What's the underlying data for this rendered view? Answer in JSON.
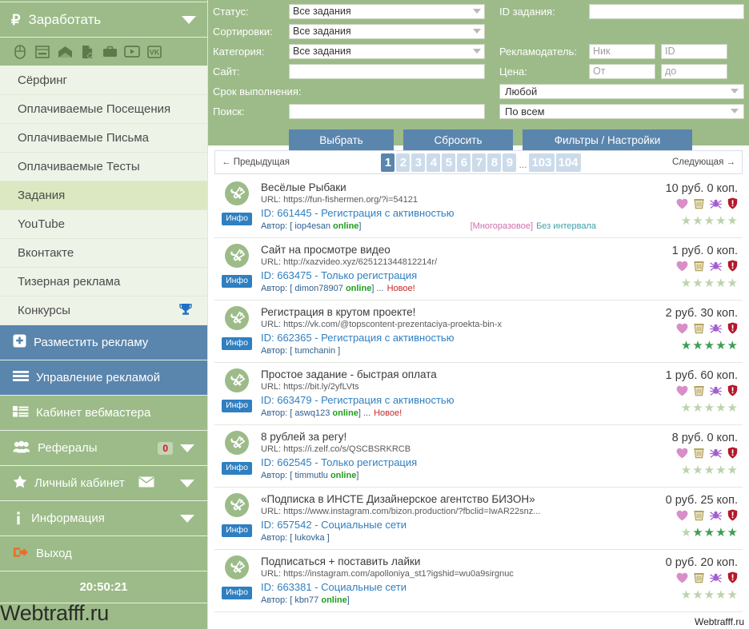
{
  "sidebar": {
    "header": {
      "label": "Заработать",
      "icon": "ruble-icon",
      "caret": "chevron-down-icon"
    },
    "quick_icons": [
      {
        "name": "mouse-icon"
      },
      {
        "name": "banner-icon"
      },
      {
        "name": "mail-open-icon"
      },
      {
        "name": "test-paper-icon"
      },
      {
        "name": "briefcase-icon"
      },
      {
        "name": "video-play-icon"
      },
      {
        "name": "vk-icon"
      }
    ],
    "items": [
      {
        "label": "Сёрфинг",
        "active": false
      },
      {
        "label": "Оплачиваемые Посещения",
        "active": false
      },
      {
        "label": "Оплачиваемые Письма",
        "active": false
      },
      {
        "label": "Оплачиваемые Тесты",
        "active": false
      },
      {
        "label": "Задания",
        "active": true
      },
      {
        "label": "YouTube",
        "active": false
      },
      {
        "label": "Вконтакте",
        "active": false
      },
      {
        "label": "Тизерная реклама",
        "active": false
      },
      {
        "label": "Конкурсы",
        "active": false,
        "trophy": true
      }
    ],
    "actions": [
      {
        "label": "Разместить рекламу",
        "style": "blue",
        "icon": "plus-square-icon"
      },
      {
        "label": "Управление рекламой",
        "style": "blue",
        "icon": "menu-bars-icon"
      },
      {
        "label": "Кабинет вебмастера",
        "style": "green",
        "icon": "list-blocks-icon"
      },
      {
        "label": "Рефералы",
        "style": "green",
        "icon": "users-icon",
        "badge": "0",
        "caret": true
      },
      {
        "label": "Личный кабинет",
        "style": "green",
        "icon": "star-icon",
        "mail": true,
        "caret": true
      },
      {
        "label": "Информация",
        "style": "green",
        "icon": "info-icon",
        "caret": true
      },
      {
        "label": "Выход",
        "style": "green",
        "icon": "logout-icon"
      }
    ],
    "clock": "20:50:21",
    "watermark": "Webtrafff.ru"
  },
  "filters": {
    "status": {
      "label": "Статус:",
      "value": "Все задания"
    },
    "sorting": {
      "label": "Сортировки:",
      "value": "Все задания"
    },
    "category": {
      "label": "Категория:",
      "value": "Все задания"
    },
    "site": {
      "label": "Сайт:",
      "value": "",
      "placeholder": ""
    },
    "deadline": {
      "label": "Срок выполнения:"
    },
    "search": {
      "label": "Поиск:",
      "value": "",
      "placeholder": ""
    },
    "task_id": {
      "label": "ID задания:",
      "value": "",
      "placeholder": ""
    },
    "advertiser": {
      "label": "Рекламодатель:",
      "nick_placeholder": "Ник",
      "id_placeholder": "ID",
      "nick_value": "",
      "id_value": ""
    },
    "price": {
      "label": "Цена:",
      "from_placeholder": "От",
      "to_placeholder": "до",
      "from_value": "",
      "to_value": ""
    },
    "deadline_select": "Любой",
    "scope_select": "По всем",
    "buttons": {
      "select": "Выбрать",
      "reset": "Сбросить",
      "settings": "Фильтры / Настройки"
    }
  },
  "pagination": {
    "prev": "← Предыдущая",
    "next": "Следующая →",
    "pages": [
      "1",
      "2",
      "3",
      "4",
      "5",
      "6",
      "7",
      "8",
      "9"
    ],
    "ellipsis": "...",
    "tail_pages": [
      "103",
      "104"
    ],
    "current": "1"
  },
  "tasks": {
    "info_badge": "Инфо",
    "author_prefix": "Автор:",
    "url_prefix": "URL:",
    "id_prefix": "ID:",
    "online_label": "online",
    "new_label": "Новое!",
    "items": [
      {
        "title": "Весёлые Рыбаки",
        "url": "URL: https://fun-fishermen.org/?i=54121",
        "id_line": "ID: 661445 - Регистрация с активностью",
        "author": "Автор: [ iop4esan",
        "online": "online",
        "author_close": "]",
        "new": "",
        "tag_multi": "[Многоразовое]",
        "tag_interval": "Без интервала",
        "price": "10 руб. 0 коп.",
        "stars": 0
      },
      {
        "title": "Сайт на просмотре видео",
        "url": "URL: http://xazvideo.xyz/625121344812214r/",
        "id_line": "ID: 663475 - Только регистрация",
        "author": "Автор: [ dimon78907",
        "online": "online",
        "author_close": "] ...",
        "new": "Новое!",
        "tag_multi": "",
        "tag_interval": "",
        "price": "1 руб. 0 коп.",
        "stars": 0
      },
      {
        "title": "Регистрация в крутом проекте!",
        "url": "URL: https://vk.com/@topscontent-prezentaciya-proekta-bin-x",
        "id_line": "ID: 662365 - Регистрация с активностью",
        "author": "Автор: [ tumchanin ]",
        "online": "",
        "author_close": "",
        "new": "",
        "tag_multi": "",
        "tag_interval": "",
        "price": "2 руб. 30 коп.",
        "stars": 5
      },
      {
        "title": "Простое задание - быстрая оплата",
        "url": "URL: https://bit.ly/2yfLVts",
        "id_line": "ID: 663479 - Регистрация с активностью",
        "author": "Автор: [ aswq123",
        "online": "online",
        "author_close": "] ...",
        "new": "Новое!",
        "tag_multi": "",
        "tag_interval": "",
        "price": "1 руб. 60 коп.",
        "stars": 0
      },
      {
        "title": "8 рублей за регу!",
        "url": "URL: https://i.zelf.co/s/QSCBSRKRCB",
        "id_line": "ID: 662545 - Только регистрация",
        "author": "Автор: [ timmutlu",
        "online": "online",
        "author_close": "]",
        "new": "",
        "tag_multi": "",
        "tag_interval": "",
        "price": "8 руб. 0 коп.",
        "stars": 0
      },
      {
        "title": "«Подписка в ИНСТЕ Дизайнерское агентство БИЗОН»",
        "url": "URL: https://www.instagram.com/bizon.production/?fbclid=IwAR22snz...",
        "id_line": "ID: 657542 - Социальные сети",
        "author": "Автор: [ lukovka ]",
        "online": "",
        "author_close": "",
        "new": "",
        "tag_multi": "",
        "tag_interval": "",
        "price": "0 руб. 25 коп.",
        "stars": 4
      },
      {
        "title": "Подписаться + поставить лайки",
        "url": "URL: https://instagram.com/apolloniya_st1?igshid=wu0a9sirgnuc",
        "id_line": "ID: 663381 - Социальные сети",
        "author": "Автор: [ kbn77",
        "online": "online",
        "author_close": "]",
        "new": "",
        "tag_multi": "",
        "tag_interval": "",
        "price": "0 руб. 20 коп.",
        "stars": 0
      }
    ],
    "action_icons": [
      {
        "name": "heart-icon",
        "color": "#d88ec8"
      },
      {
        "name": "basket-icon",
        "color": "#b0a060"
      },
      {
        "name": "spider-icon",
        "color": "#a35fd0"
      },
      {
        "name": "complaint-icon",
        "color": "#b3182b"
      }
    ],
    "watermark": "Webtrafff.ru"
  },
  "colors": {
    "sidebar_green": "#9cbb88",
    "sidebar_light": "#eef3e7",
    "accent_blue": "#5a85ad",
    "link_blue": "#2f7fc1",
    "star_on": "#3f9e55",
    "star_off": "#bcd3ae"
  }
}
